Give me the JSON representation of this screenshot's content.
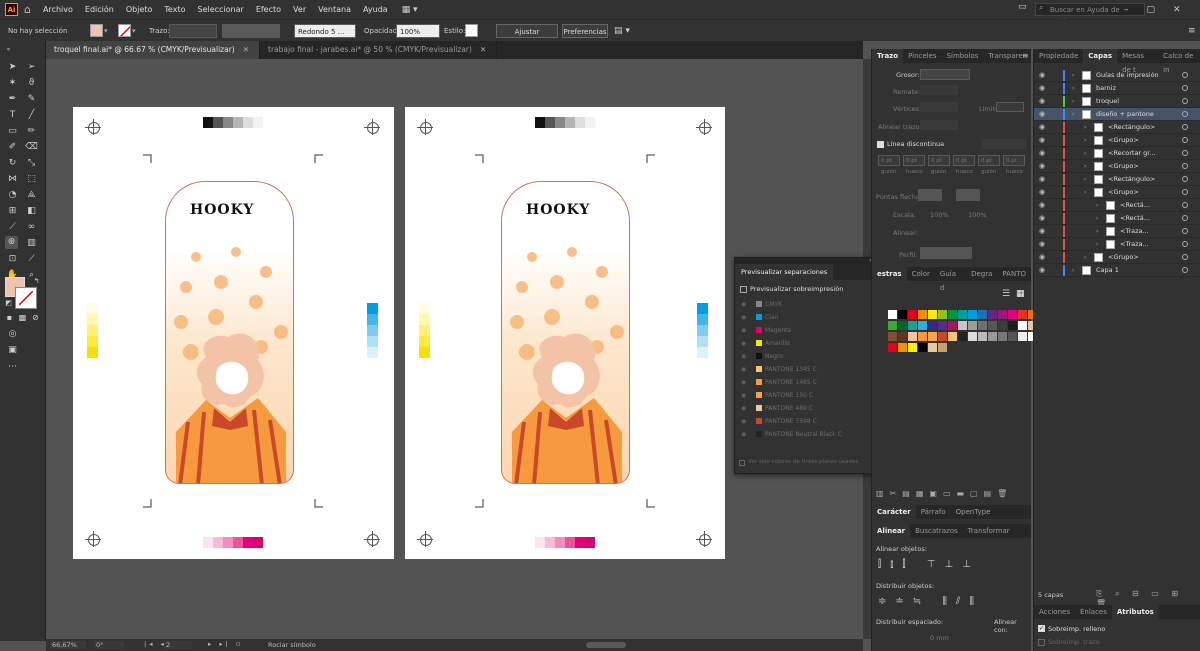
{
  "menu": {
    "items": [
      "Archivo",
      "Edición",
      "Objeto",
      "Texto",
      "Seleccionar",
      "Efecto",
      "Ver",
      "Ventana",
      "Ayuda"
    ],
    "search_placeholder": "Buscar en Ayuda de Adobe"
  },
  "control": {
    "selection_label": "No hay selección",
    "stroke_label": "Trazo:",
    "brush_value": "Redondo 5 ...",
    "opacity_label": "Opacidad:",
    "opacity_value": "100%",
    "style_label": "Estilo:",
    "adjust_doc": "Ajustar documento",
    "prefs": "Preferencias"
  },
  "tabs": [
    {
      "label": "troquel final.ai* @ 66.67 % (CMYK/Previsualizar)",
      "active": true
    },
    {
      "label": "trabajo final - jarabes.ai* @ 50 % (CMYK/Previsualizar)",
      "active": false
    }
  ],
  "brand_text": "HOOKY",
  "status": {
    "zoom": "66,67%",
    "rotation": "0°",
    "page": "2",
    "tool": "Rociar símbolo"
  },
  "stroke_panel": {
    "tabs": [
      "Trazo",
      "Pinceles",
      "Símbolos",
      "Transparen"
    ],
    "grosor_label": "Grosor:",
    "remate_label": "Remate:",
    "vertices_label": "Vértices:",
    "limite_label": "Límite:",
    "alinear_label": "Alinear trazo:",
    "dashed_label": "Línea discontinua",
    "dash_values": [
      "0 pt",
      "0 pt",
      "0 pt",
      "0 pt",
      "0 pt",
      "0 pt"
    ],
    "dash_sub": [
      "guión",
      "hueco",
      "guión",
      "hueco",
      "guión",
      "hueco"
    ],
    "puntas_label": "Puntas flecha:",
    "escala_label": "Escala:",
    "escala_value1": "100%",
    "escala_value2": "100%",
    "alinear2_label": "Alinear:",
    "perfil_label": "Perfil:"
  },
  "swatch_tabs": [
    "estras",
    "Color",
    "Guía d",
    "Degra",
    "PANTO"
  ],
  "char_tabs": [
    "Carácter",
    "Párrafo",
    "OpenType"
  ],
  "align_tabs": [
    "Alinear",
    "Buscatrazos",
    "Transformar"
  ],
  "align": {
    "objects_label": "Alinear objetos:",
    "distribute_label": "Distribuir objetos:",
    "spacing_label": "Distribuir espaciado:",
    "align_with_label": "Alinear con:",
    "spacing_value": "0 mm"
  },
  "layers_panel": {
    "tabs": [
      "Propiedade",
      "Capas",
      "Mesas de t",
      "Calco de in"
    ],
    "layers": [
      {
        "name": "Guías de impresión",
        "color": "#4f7dff",
        "indent": 0
      },
      {
        "name": "barniz",
        "color": "#4f7dff",
        "indent": 0
      },
      {
        "name": "troquel",
        "color": "#4fcf4f",
        "indent": 0
      },
      {
        "name": "diseño + pantone",
        "color": "#4f7dff",
        "indent": 0,
        "selected": true
      },
      {
        "name": "<Rectángulo>",
        "color": "#e05050",
        "indent": 1
      },
      {
        "name": "<Grupo>",
        "color": "#e05050",
        "indent": 1
      },
      {
        "name": "<Recortar gr...",
        "color": "#e05050",
        "indent": 1
      },
      {
        "name": "<Grupo>",
        "color": "#e05050",
        "indent": 1
      },
      {
        "name": "<Rectángulo>",
        "color": "#e05050",
        "indent": 1
      },
      {
        "name": "<Grupo>",
        "color": "#e05050",
        "indent": 1
      },
      {
        "name": "<Rectá...",
        "color": "#e05050",
        "indent": 2
      },
      {
        "name": "<Rectá...",
        "color": "#e05050",
        "indent": 2
      },
      {
        "name": "<Traza...",
        "color": "#e05050",
        "indent": 2
      },
      {
        "name": "<Traza...",
        "color": "#e05050",
        "indent": 2
      },
      {
        "name": "<Grupo>",
        "color": "#e05050",
        "indent": 1
      },
      {
        "name": "Capa 1",
        "color": "#4f7dff",
        "indent": 0
      }
    ],
    "count": "5 capas"
  },
  "bottom_tabs": [
    "Acciones",
    "Enlaces",
    "Atributos"
  ],
  "attributes": {
    "overprint_fill": "Sobreimp. relleno",
    "overprint_stroke": "Sobreimp. trazo"
  },
  "separations": {
    "title": "Previsualizar separaciones",
    "checkbox": "Previsualizar sobreimpresión",
    "rows": [
      {
        "name": "CMYK",
        "color": "#888888"
      },
      {
        "name": "Cian",
        "color": "#00a0e0"
      },
      {
        "name": "Magenta",
        "color": "#e0007a"
      },
      {
        "name": "Amarillo",
        "color": "#f5e600"
      },
      {
        "name": "Negro",
        "color": "#111111"
      },
      {
        "name": "PANTONE 1345 C",
        "color": "#f7c27a"
      },
      {
        "name": "PANTONE 1485 C",
        "color": "#f79a3e"
      },
      {
        "name": "PANTONE 150 C",
        "color": "#f6a64a"
      },
      {
        "name": "PANTONE 489 C",
        "color": "#f2c3a6"
      },
      {
        "name": "PANTONE 7598 C",
        "color": "#c8482a"
      },
      {
        "name": "PANTONE Neutral Black C",
        "color": "#222222"
      }
    ],
    "footer": "Ver solo colores de tintas planas usadas"
  }
}
